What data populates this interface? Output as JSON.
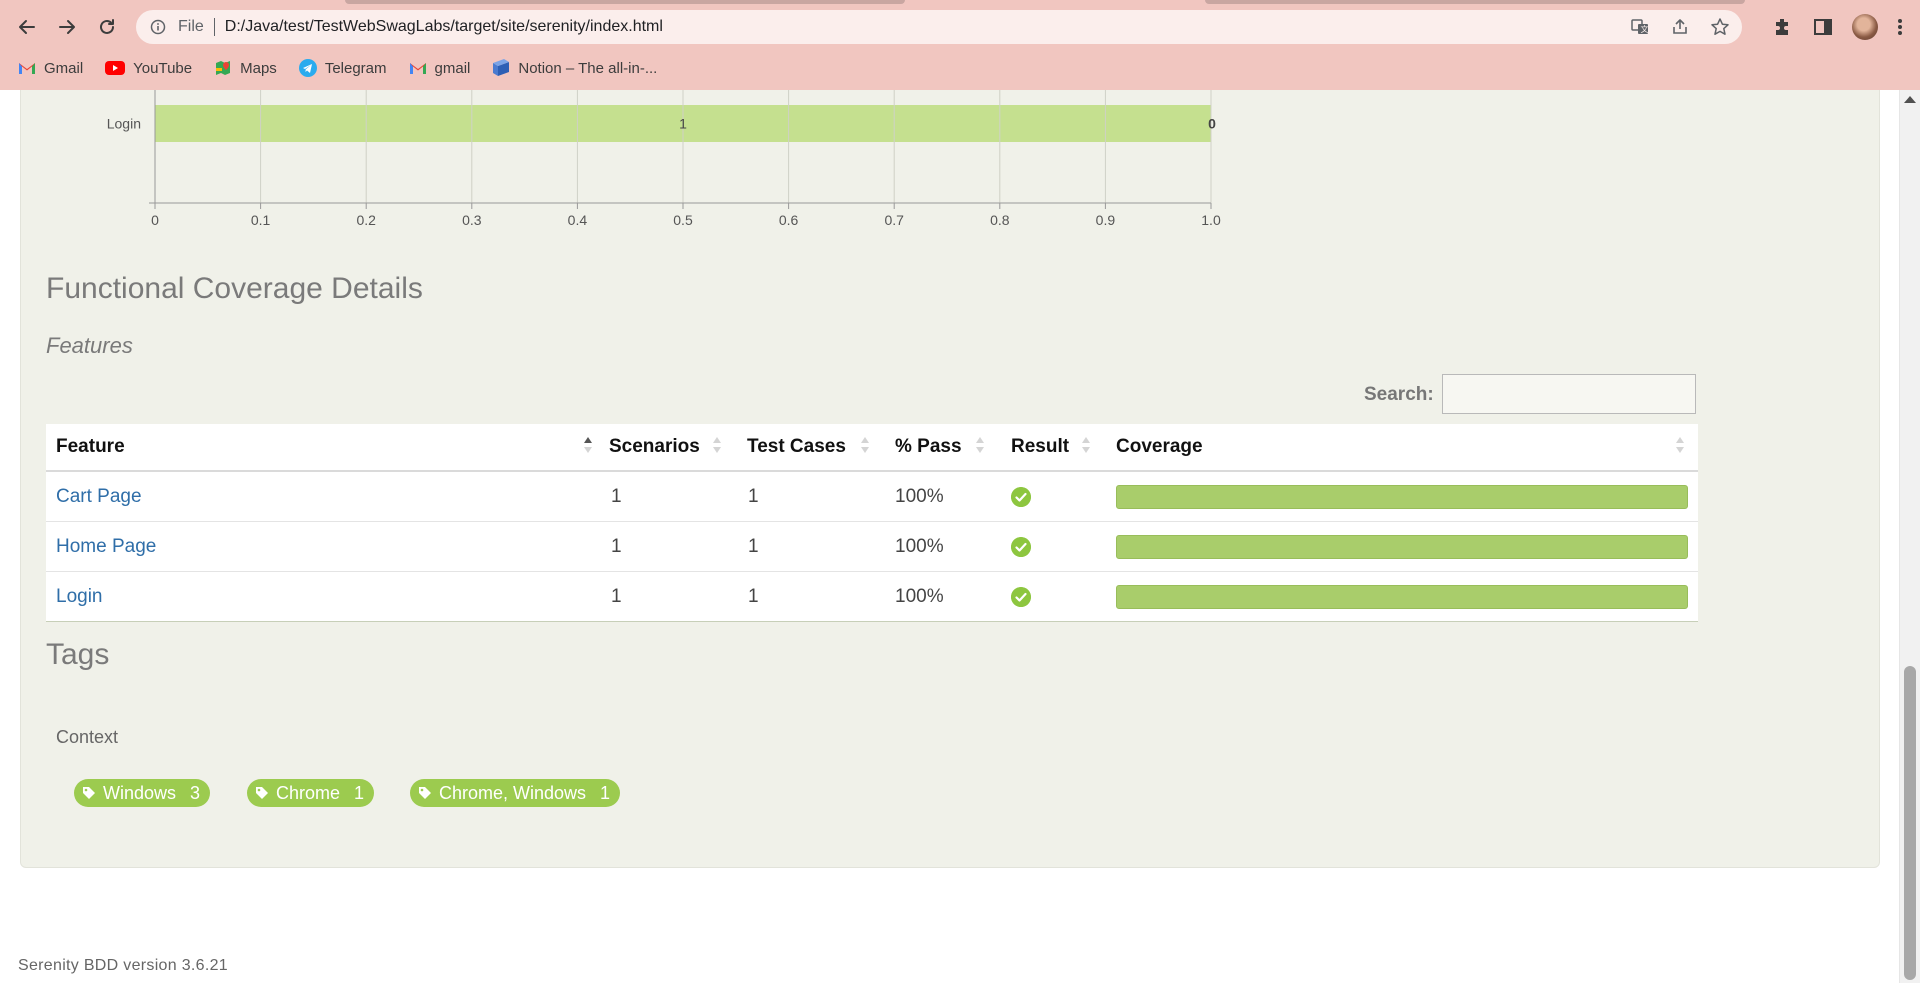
{
  "browser": {
    "url_scheme": "File",
    "url": "D:/Java/test/TestWebSwagLabs/target/site/serenity/index.html",
    "bookmarks": [
      {
        "label": "Gmail",
        "icon": "gmail-icon"
      },
      {
        "label": "YouTube",
        "icon": "youtube-icon"
      },
      {
        "label": "Maps",
        "icon": "maps-icon"
      },
      {
        "label": "Telegram",
        "icon": "telegram-icon"
      },
      {
        "label": "gmail",
        "icon": "gmail-icon"
      },
      {
        "label": "Notion – The all-in-...",
        "icon": "notion-icon"
      }
    ]
  },
  "chart": {
    "categories": [
      "Login"
    ],
    "bar_labels": [
      "1",
      "0"
    ],
    "ticks": [
      "0",
      "0.1",
      "0.2",
      "0.3",
      "0.4",
      "0.5",
      "0.6",
      "0.7",
      "0.8",
      "0.9",
      "1.0"
    ],
    "values": [
      1.0
    ],
    "xlim": [
      0,
      1.0
    ],
    "bar_color": "#c5e08f"
  },
  "coverage": {
    "title": "Functional Coverage Details",
    "subtitle": "Features",
    "search_label": "Search:",
    "search_value": "",
    "columns": [
      "Feature",
      "Scenarios",
      "Test Cases",
      "% Pass",
      "Result",
      "Coverage"
    ],
    "rows": [
      {
        "feature": "Cart Page",
        "scenarios": "1",
        "test_cases": "1",
        "pass": "100%",
        "result": "passed",
        "coverage": 1.0
      },
      {
        "feature": "Home Page",
        "scenarios": "1",
        "test_cases": "1",
        "pass": "100%",
        "result": "passed",
        "coverage": 1.0
      },
      {
        "feature": "Login",
        "scenarios": "1",
        "test_cases": "1",
        "pass": "100%",
        "result": "passed",
        "coverage": 1.0
      }
    ],
    "pass_color": "#8dc63f",
    "coverage_color": "#a9cd6b"
  },
  "tags": {
    "title": "Tags",
    "context_label": "Context",
    "items": [
      {
        "label": "Windows",
        "count": "3"
      },
      {
        "label": "Chrome",
        "count": "1"
      },
      {
        "label": "Chrome, Windows",
        "count": "1"
      }
    ],
    "tag_color": "#9ccb4f"
  },
  "footer": {
    "version": "Serenity BDD version 3.6.21"
  }
}
